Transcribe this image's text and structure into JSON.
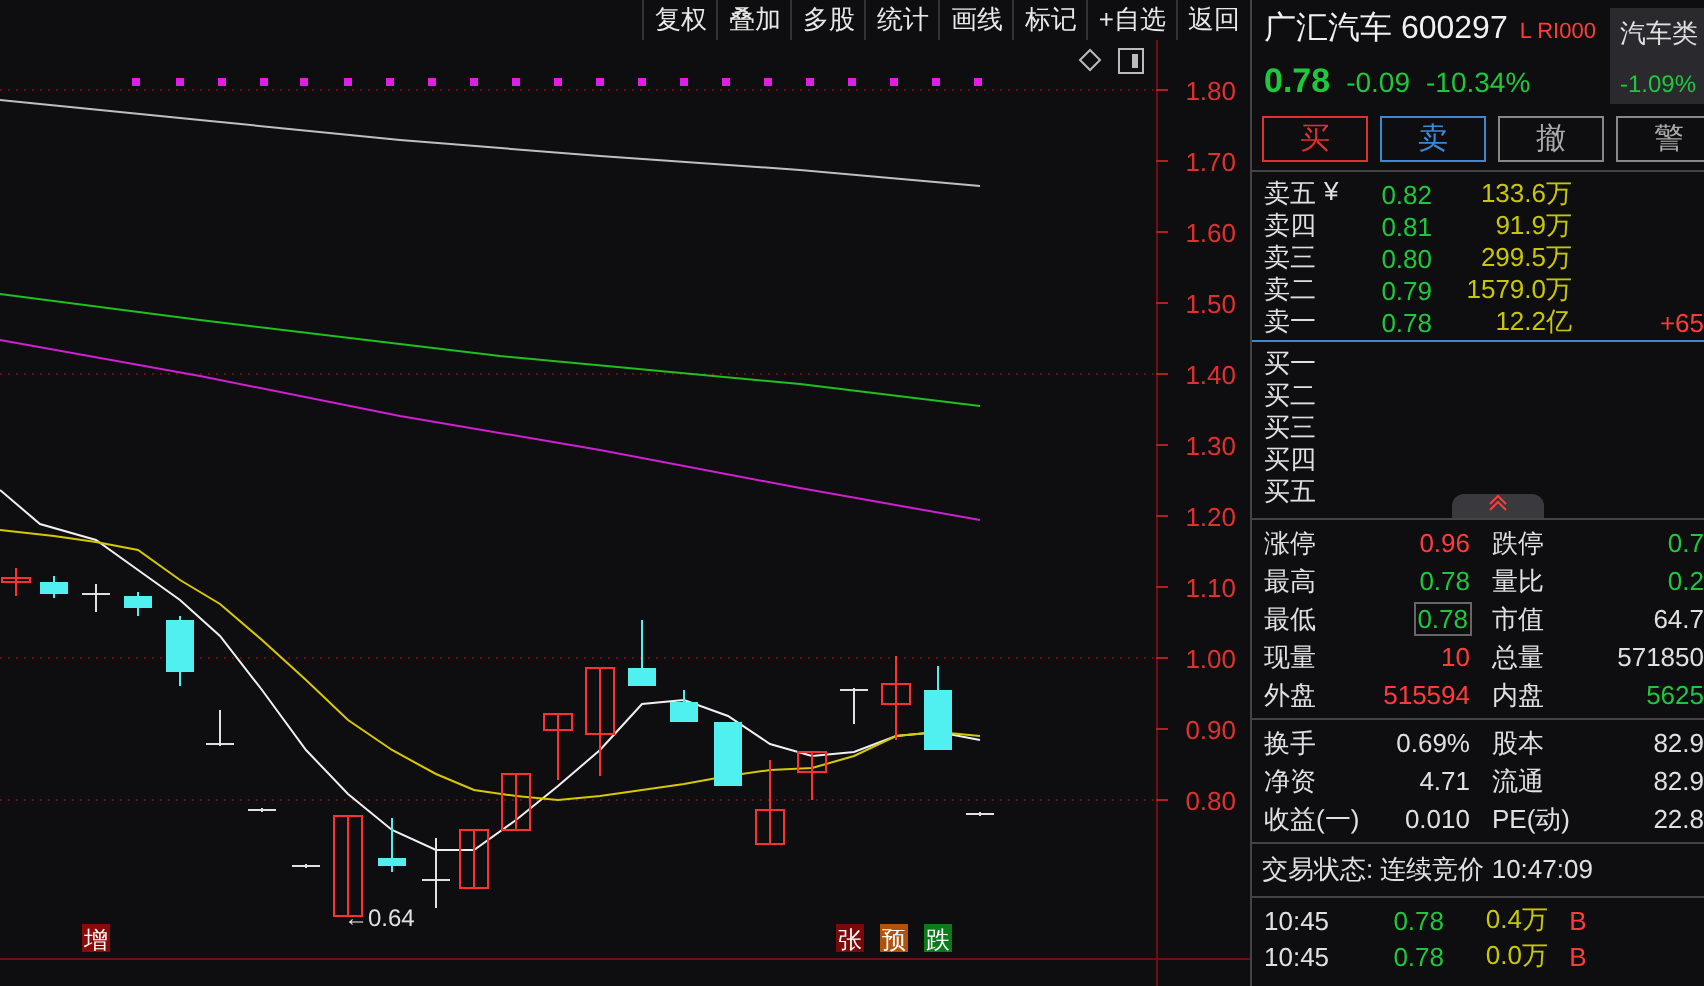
{
  "toolbar": [
    "复权",
    "叠加",
    "多股",
    "统计",
    "画线",
    "标记",
    "+自选",
    "返回"
  ],
  "chart": {
    "price_labels": [
      "1.80",
      "1.70",
      "1.60",
      "1.50",
      "1.40",
      "1.30",
      "1.20",
      "1.10",
      "1.00",
      "0.90",
      "0.80"
    ],
    "low_marker": "←0.64",
    "left_signals": [
      {
        "label": "增",
        "color": "#8a0a0a"
      }
    ],
    "right_signals": [
      {
        "label": "张",
        "color": "#7a0a0a"
      },
      {
        "label": "预",
        "color": "#b0520a"
      },
      {
        "label": "跌",
        "color": "#0a7a1a"
      }
    ]
  },
  "quote": {
    "name": "广汇汽车 600297",
    "flags": "L RI000",
    "price": "0.78",
    "change": "-0.09",
    "change_pct": "-10.34%",
    "sector": "汽车类",
    "sector_change": "-1.09%"
  },
  "actions": [
    {
      "label": "买",
      "kind": "buy"
    },
    {
      "label": "卖",
      "kind": "sell"
    },
    {
      "label": "撤",
      "kind": "plain"
    },
    {
      "label": "警",
      "kind": "plain"
    }
  ],
  "asks": [
    {
      "label": "卖五",
      "suffix": "¥",
      "price": "0.82",
      "volume": "133.6万"
    },
    {
      "label": "卖四",
      "price": "0.81",
      "volume": "91.9万"
    },
    {
      "label": "卖三",
      "price": "0.80",
      "volume": "299.5万"
    },
    {
      "label": "卖二",
      "price": "0.79",
      "volume": "1579.0万"
    },
    {
      "label": "卖一",
      "price": "0.78",
      "volume": "12.2亿",
      "delta": "+65"
    }
  ],
  "bids": [
    {
      "label": "买一"
    },
    {
      "label": "买二"
    },
    {
      "label": "买三"
    },
    {
      "label": "买四"
    },
    {
      "label": "买五"
    }
  ],
  "stats_a": [
    [
      {
        "label": "涨停",
        "value": "0.96",
        "color": "#ff3b3b",
        "boxed": false
      },
      {
        "label": "跌停",
        "value": "0.7",
        "color": "#1ec83c",
        "boxed": false
      }
    ],
    [
      {
        "label": "最高",
        "value": "0.78",
        "color": "#1ec83c",
        "boxed": false
      },
      {
        "label": "量比",
        "value": "0.2",
        "color": "#1ec83c",
        "boxed": false
      }
    ],
    [
      {
        "label": "最低",
        "value": "0.78",
        "color": "#1ec83c",
        "boxed": true
      },
      {
        "label": "市值",
        "value": "64.7",
        "color": "#e0e0e0",
        "boxed": false
      }
    ],
    [
      {
        "label": "现量",
        "value": "10",
        "color": "#ff3b3b",
        "boxed": false
      },
      {
        "label": "总量",
        "value": "571850",
        "color": "#e0e0e0",
        "boxed": false
      }
    ],
    [
      {
        "label": "外盘",
        "value": "515594",
        "color": "#ff3b3b",
        "boxed": false
      },
      {
        "label": "内盘",
        "value": "5625",
        "color": "#1ec83c",
        "boxed": false
      }
    ]
  ],
  "stats_b": [
    [
      {
        "label": "换手",
        "value": "0.69%",
        "color": "#e0e0e0",
        "boxed": false
      },
      {
        "label": "股本",
        "value": "82.9",
        "color": "#e0e0e0",
        "boxed": false
      }
    ],
    [
      {
        "label": "净资",
        "value": "4.71",
        "color": "#e0e0e0",
        "boxed": false
      },
      {
        "label": "流通",
        "value": "82.9",
        "color": "#e0e0e0",
        "boxed": false
      }
    ],
    [
      {
        "label": "收益(一)",
        "value": "0.010",
        "color": "#e0e0e0",
        "boxed": false
      },
      {
        "label": "PE(动)",
        "value": "22.8",
        "color": "#e0e0e0",
        "boxed": false
      }
    ]
  ],
  "trade_status": "交易状态: 连续竞价 10:47:09",
  "ticks": [
    {
      "time": "10:45",
      "price": "0.78",
      "volume": "0.4万",
      "side": "B"
    },
    {
      "time": "10:45",
      "price": "0.78",
      "volume": "0.0万",
      "side": "B"
    }
  ]
}
